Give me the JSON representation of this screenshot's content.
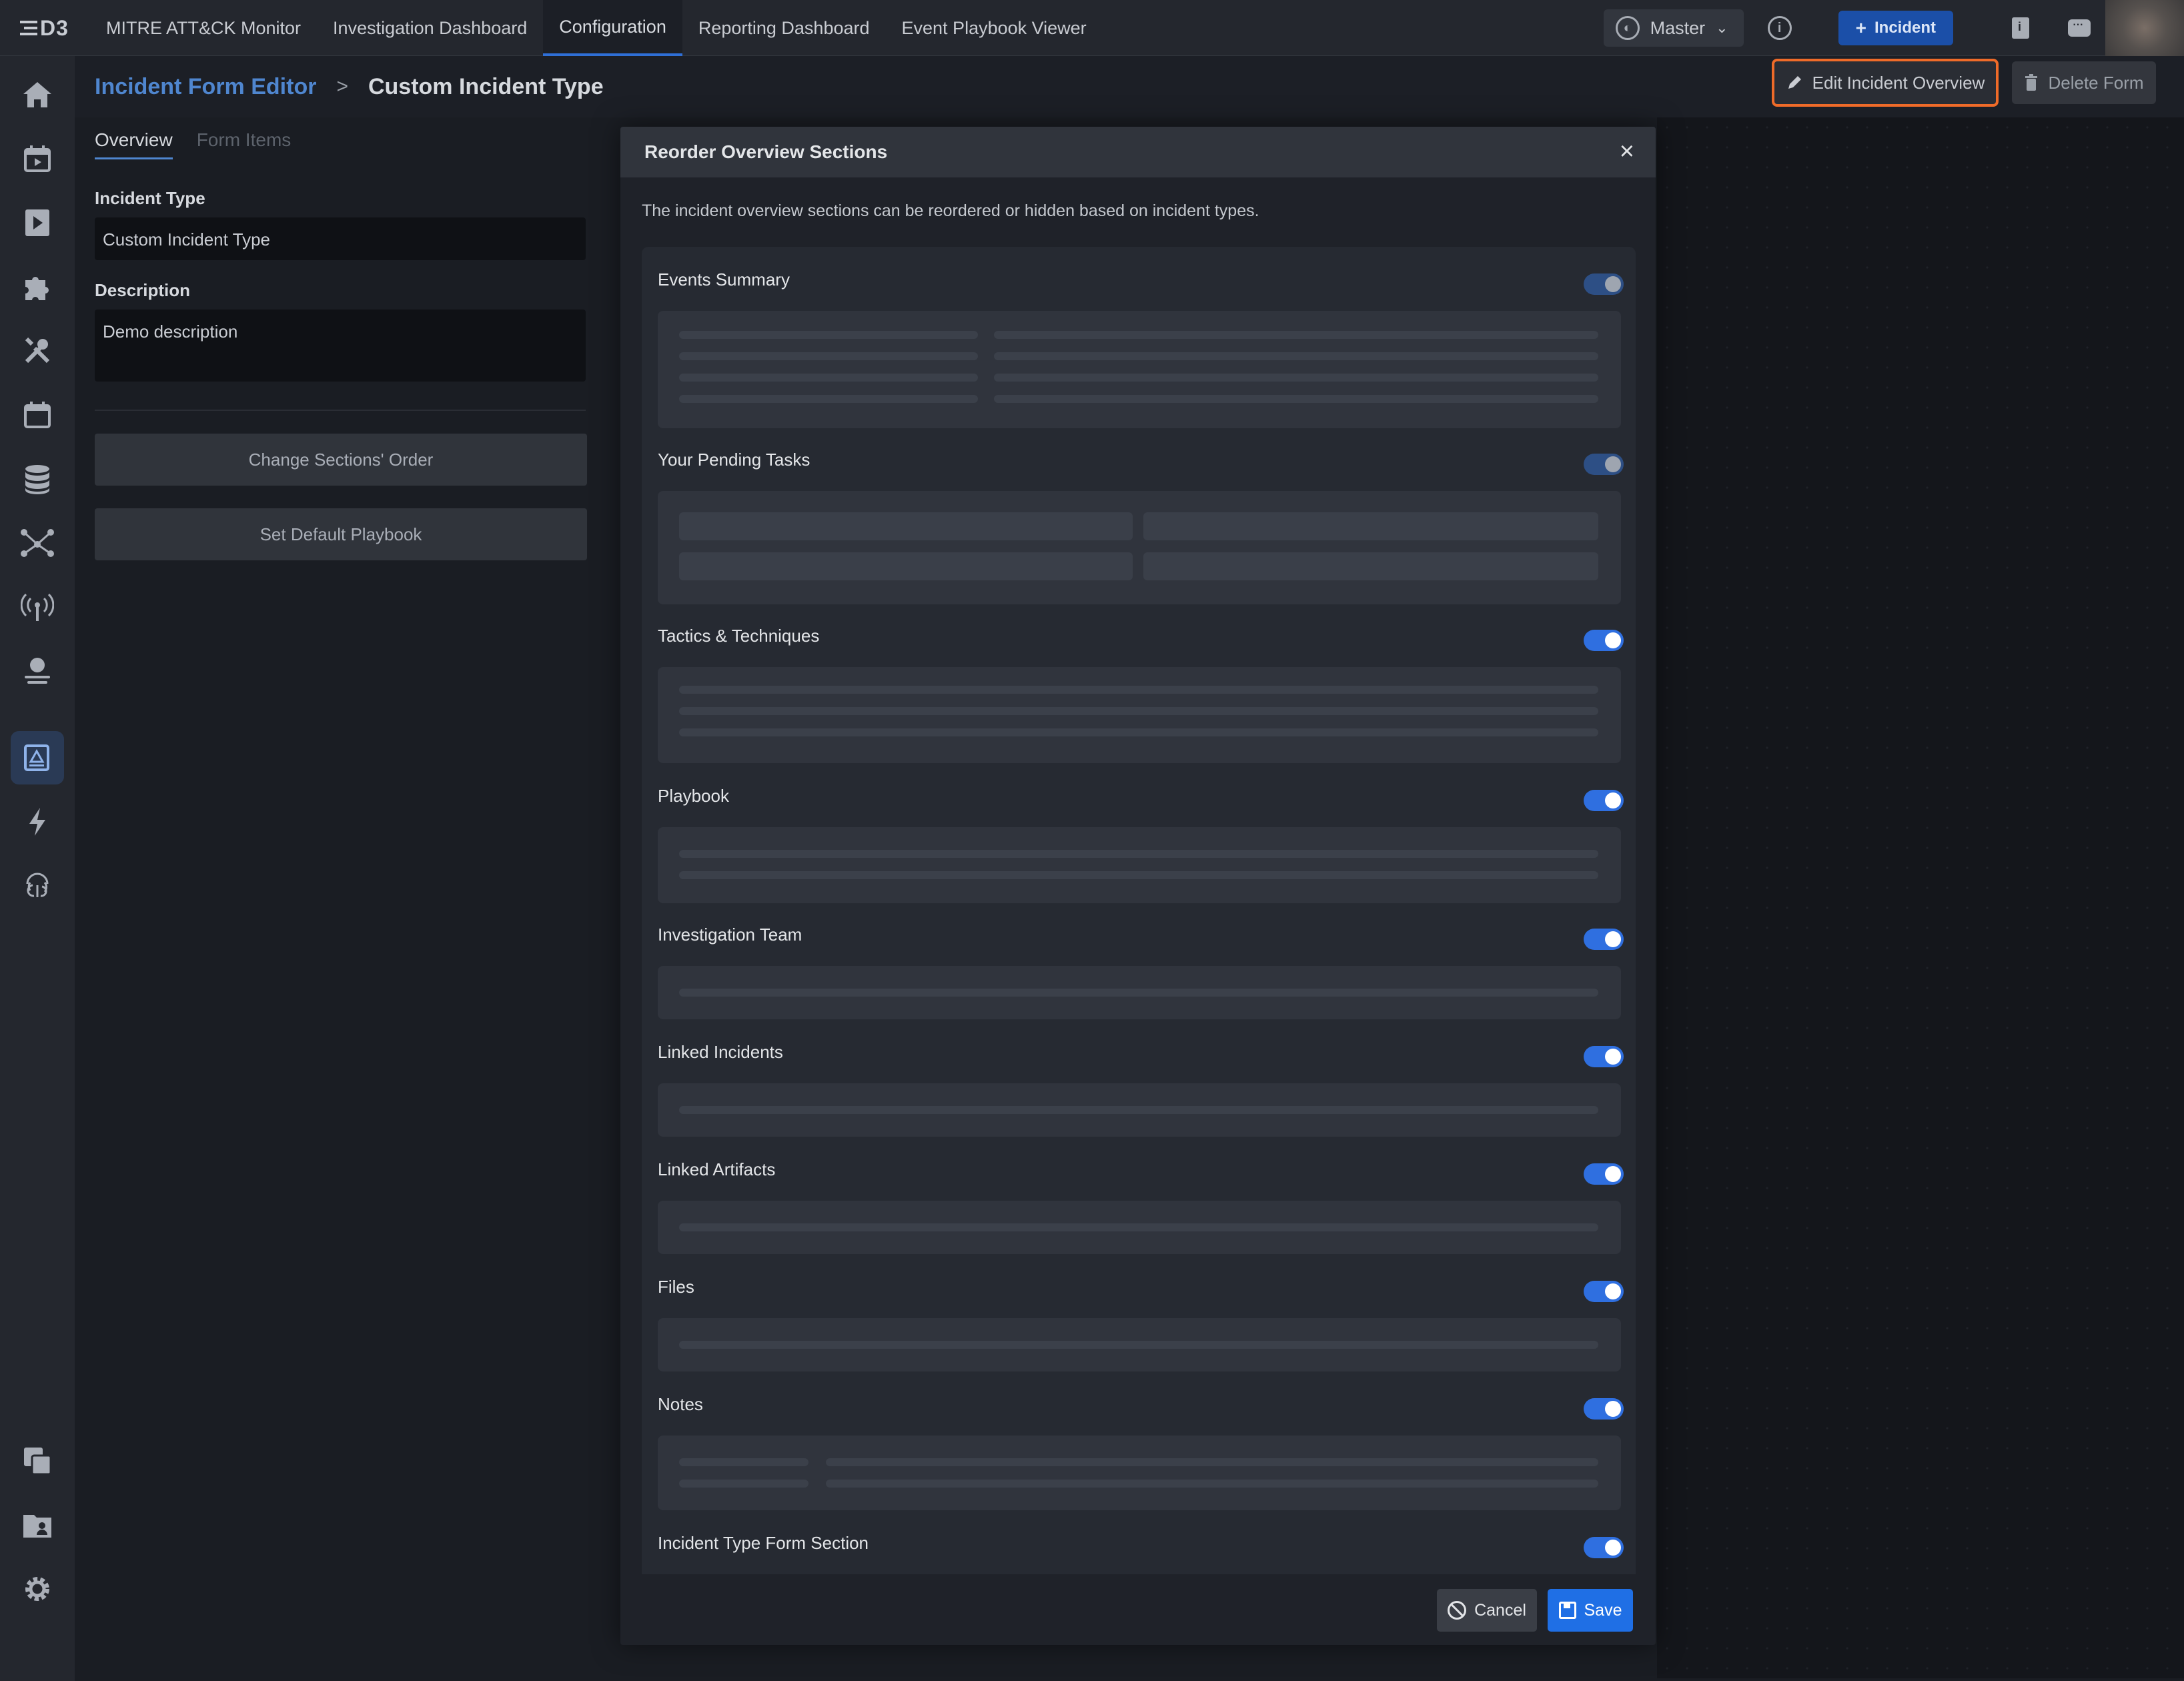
{
  "app": {
    "logo": "D3"
  },
  "topnav": {
    "tabs": [
      {
        "label": "MITRE ATT&CK Monitor"
      },
      {
        "label": "Investigation Dashboard"
      },
      {
        "label": "Configuration"
      },
      {
        "label": "Reporting Dashboard"
      },
      {
        "label": "Event Playbook Viewer"
      }
    ],
    "active_tab": "Configuration",
    "site_selector": "Master",
    "incident_button": "Incident"
  },
  "sidebar": {
    "icons": [
      "home-icon",
      "calendar-play-icon",
      "play-icon",
      "puzzle-icon",
      "tools-icon",
      "calendar-icon",
      "database-icon",
      "graph-icon",
      "antenna-icon",
      "globe-user-icon",
      "form-editor-icon",
      "lightning-sync-icon",
      "fingerprint-icon",
      "copy-icon",
      "folder-user-icon",
      "gear-icon"
    ],
    "active": "form-editor-icon"
  },
  "breadcrumb": {
    "parent": "Incident Form Editor",
    "separator": ">",
    "current": "Custom Incident Type"
  },
  "header_actions": {
    "edit_overview": "Edit Incident Overview",
    "delete_form": "Delete Form"
  },
  "left_panel": {
    "tabs": [
      "Overview",
      "Form Items"
    ],
    "active_tab": "Overview",
    "incident_type_label": "Incident Type",
    "incident_type_value": "Custom Incident Type",
    "description_label": "Description",
    "description_value": "Demo description",
    "change_order_button": "Change Sections' Order",
    "default_playbook_button": "Set Default Playbook"
  },
  "modal": {
    "title": "Reorder Overview Sections",
    "close": "×",
    "description": "The incident overview sections can be reordered or hidden based on incident types.",
    "sections": [
      {
        "label": "Events Summary",
        "enabled": true,
        "locked": true
      },
      {
        "label": "Your Pending Tasks",
        "enabled": true,
        "locked": true
      },
      {
        "label": "Tactics & Techniques",
        "enabled": true,
        "locked": false
      },
      {
        "label": "Playbook",
        "enabled": true,
        "locked": false
      },
      {
        "label": "Investigation Team",
        "enabled": true,
        "locked": false
      },
      {
        "label": "Linked Incidents",
        "enabled": true,
        "locked": false
      },
      {
        "label": "Linked Artifacts",
        "enabled": true,
        "locked": false
      },
      {
        "label": "Files",
        "enabled": true,
        "locked": false
      },
      {
        "label": "Notes",
        "enabled": true,
        "locked": false
      },
      {
        "label": "Incident Type Form Section",
        "enabled": true,
        "locked": false
      }
    ],
    "cancel_button": "Cancel",
    "save_button": "Save"
  },
  "colors": {
    "accent": "#2f6fe0",
    "highlight_border": "#ef6b29",
    "link": "#4f86cf"
  }
}
